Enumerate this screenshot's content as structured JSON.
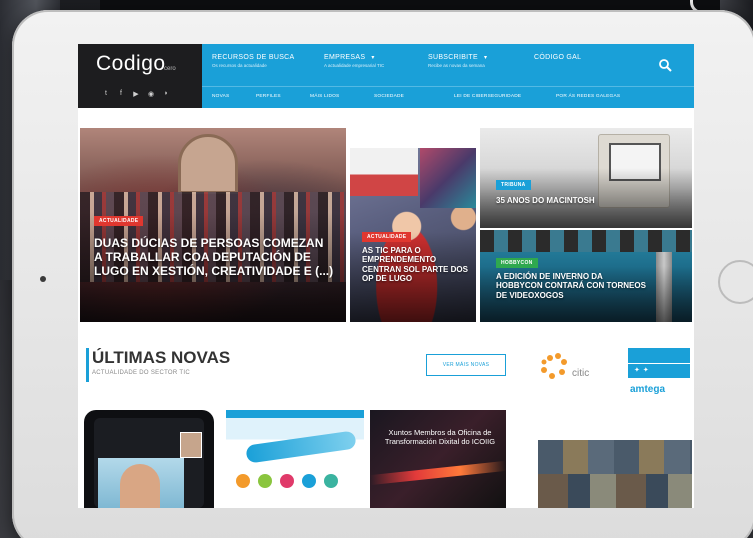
{
  "header": {
    "logo": "Codigo",
    "logo_suffix": "cero",
    "social_icons": [
      "twitter-icon",
      "facebook-icon",
      "youtube-icon",
      "instagram-icon",
      "rss-icon"
    ]
  },
  "nav": {
    "main": [
      {
        "label": "RECURSOS DE BUSCA",
        "sub": "Os recursos da actualidade"
      },
      {
        "label": "EMPRESAS",
        "sub": "A actualidade empresarial TIC"
      },
      {
        "label": "SUBSCRIBITE",
        "sub": "Recibe as novas da semana"
      },
      {
        "label": "CÓDIGO GAL",
        "sub": ""
      }
    ],
    "sub": [
      "NOVAS",
      "PERFILES",
      "MÁIS LIDOS",
      "SOCIEDADE",
      "LEI DE CIBERSEGURIDADE",
      "POR ÁS REDES GALEGAS"
    ]
  },
  "featured": [
    {
      "badge": "ACTUALIDADE",
      "title": "DUAS DÚCIAS DE PERSOAS COMEZAN A TRABALLAR COA DEPUTACIÓN DE LUGO EN XESTIÓN, CREATIVIDADE E (...)"
    },
    {
      "badge": "ACTUALIDADE",
      "title": "AS TIC PARA O EMPRENDEMENTO CENTRAN SOL PARTE DOS OP DE LUGO"
    },
    {
      "badge": "TRIBUNA",
      "title": "35 ANOS DO MACINTOSH"
    },
    {
      "badge": "HOBBYCON",
      "title": "A EDICIÓN DE INVERNO DA HOBBYCON CONTARÁ CON TORNEOS DE VIDEOXOGOS"
    }
  ],
  "latest": {
    "title": "ÚLTIMAS NOVAS",
    "subtitle": "ACTUALIDADE DO SECTOR TIC",
    "see_more": "VER MÁIS NOVAS",
    "sponsors": [
      "citic",
      "amtega"
    ]
  },
  "cards": [
    {
      "text": ""
    },
    {
      "text": ""
    },
    {
      "text": "Xuntos Membros da Oficina de Transformación Dixital do ICOIIG"
    },
    {
      "text": ""
    }
  ],
  "colors": {
    "accent": "#1aa0d8",
    "header_dark": "#1d1d1f",
    "badge_blue": "#1aa0d8",
    "badge_red": "#e0372f",
    "badge_green": "#2fa84f"
  }
}
